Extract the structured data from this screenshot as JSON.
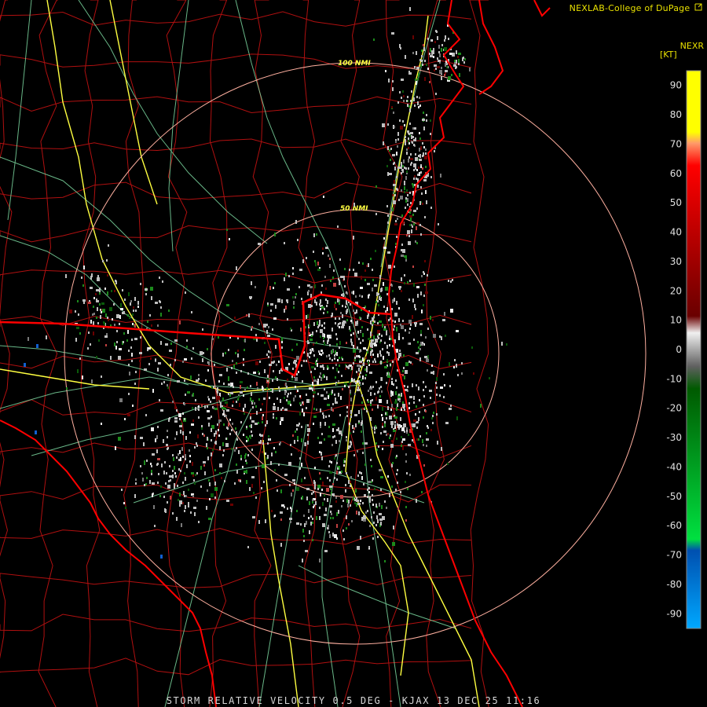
{
  "credit": {
    "text": "NEXLAB-College of DuPage",
    "icon": "external-link-icon"
  },
  "legend": {
    "product": "NEXR",
    "units": "[KT]",
    "range": [
      -95,
      95
    ],
    "ticks": [
      90,
      80,
      70,
      60,
      50,
      40,
      30,
      20,
      10,
      0,
      -10,
      -20,
      -30,
      -40,
      -50,
      -60,
      -70,
      -80,
      -90
    ],
    "colors": {
      "outbound_high": "#ffff00",
      "outbound_mid": "#ff9a6a",
      "outbound": "#ff0000",
      "outbound_low": "#6a0000",
      "neutral_high": "#f0f0f0",
      "neutral_low": "#606060",
      "inbound_low": "#005a00",
      "inbound": "#00e040",
      "inbound_mid": "#0050b0",
      "inbound_high": "#00a8ff"
    }
  },
  "map": {
    "range_rings": [
      {
        "label": "100 NMI"
      },
      {
        "label": "50 NMI"
      }
    ],
    "colors": {
      "state_border": "#ff0000",
      "coastline": "#ff0000",
      "county": "#b01010",
      "highway": "#ffff40",
      "road": "#7cd8a0",
      "ring": "#ffb0a0"
    }
  },
  "caption": "STORM RELATIVE VELOCITY 0.5 DEG - KJAX 13 DEC 25 11:16"
}
